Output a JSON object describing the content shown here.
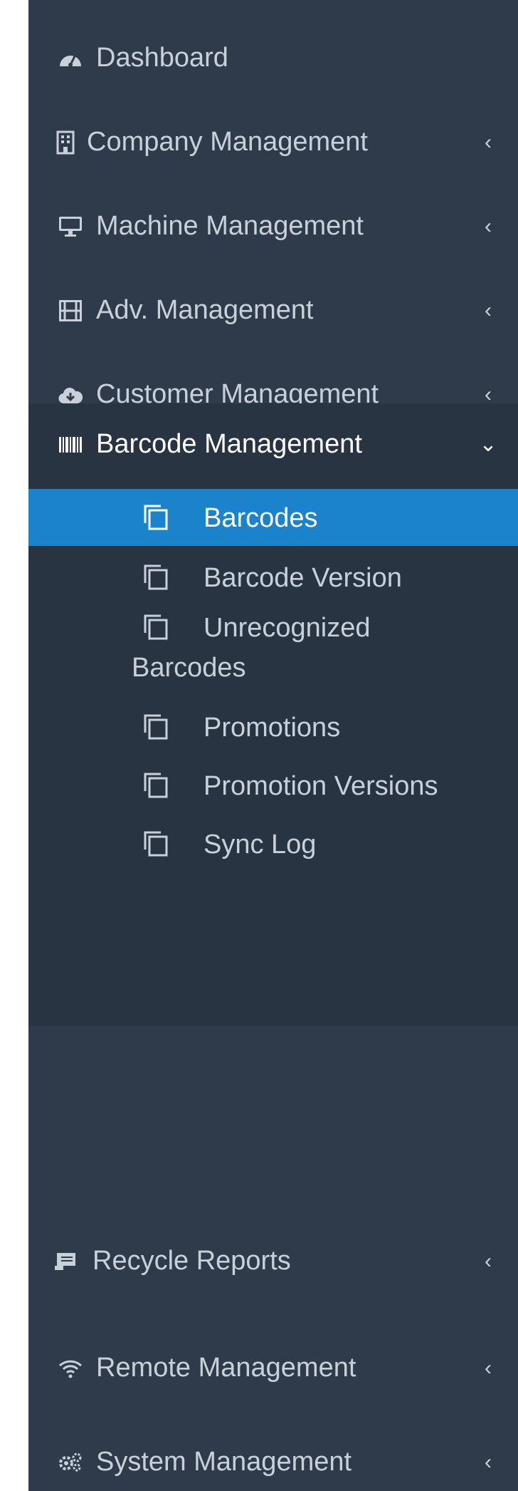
{
  "menu": {
    "items": [
      {
        "label": "Dashboard",
        "icon": "dashboard-icon"
      },
      {
        "label": "Company Management",
        "icon": "building-icon",
        "chevron": "‹"
      },
      {
        "label": "Machine Management",
        "icon": "monitor-icon",
        "chevron": "‹"
      },
      {
        "label": "Adv. Management",
        "icon": "film-icon",
        "chevron": "‹"
      },
      {
        "label": "Customer Management",
        "icon": "cloud-download-icon",
        "chevron": "‹"
      },
      {
        "label": "Barcode Management",
        "icon": "barcode-icon",
        "chevron": "⌄"
      },
      {
        "label": "Recycle Reports",
        "icon": "report-icon",
        "chevron": "‹"
      },
      {
        "label": "Remote Management",
        "icon": "wifi-icon",
        "chevron": "‹"
      },
      {
        "label": "System Management",
        "icon": "gears-icon",
        "chevron": "‹"
      }
    ],
    "sub": [
      {
        "label": "Barcodes",
        "active": true
      },
      {
        "label": "Barcode Version"
      },
      {
        "label": "Unrecognized",
        "label2": "Barcodes"
      },
      {
        "label": "Promotions"
      },
      {
        "label": "Promotion Versions"
      },
      {
        "label": "Sync Log"
      }
    ]
  },
  "colors": {
    "sidebar_bg": "#2f3b4a",
    "group_bg": "#283442",
    "active_bg": "#1b82cc",
    "text": "#c8d1db"
  }
}
